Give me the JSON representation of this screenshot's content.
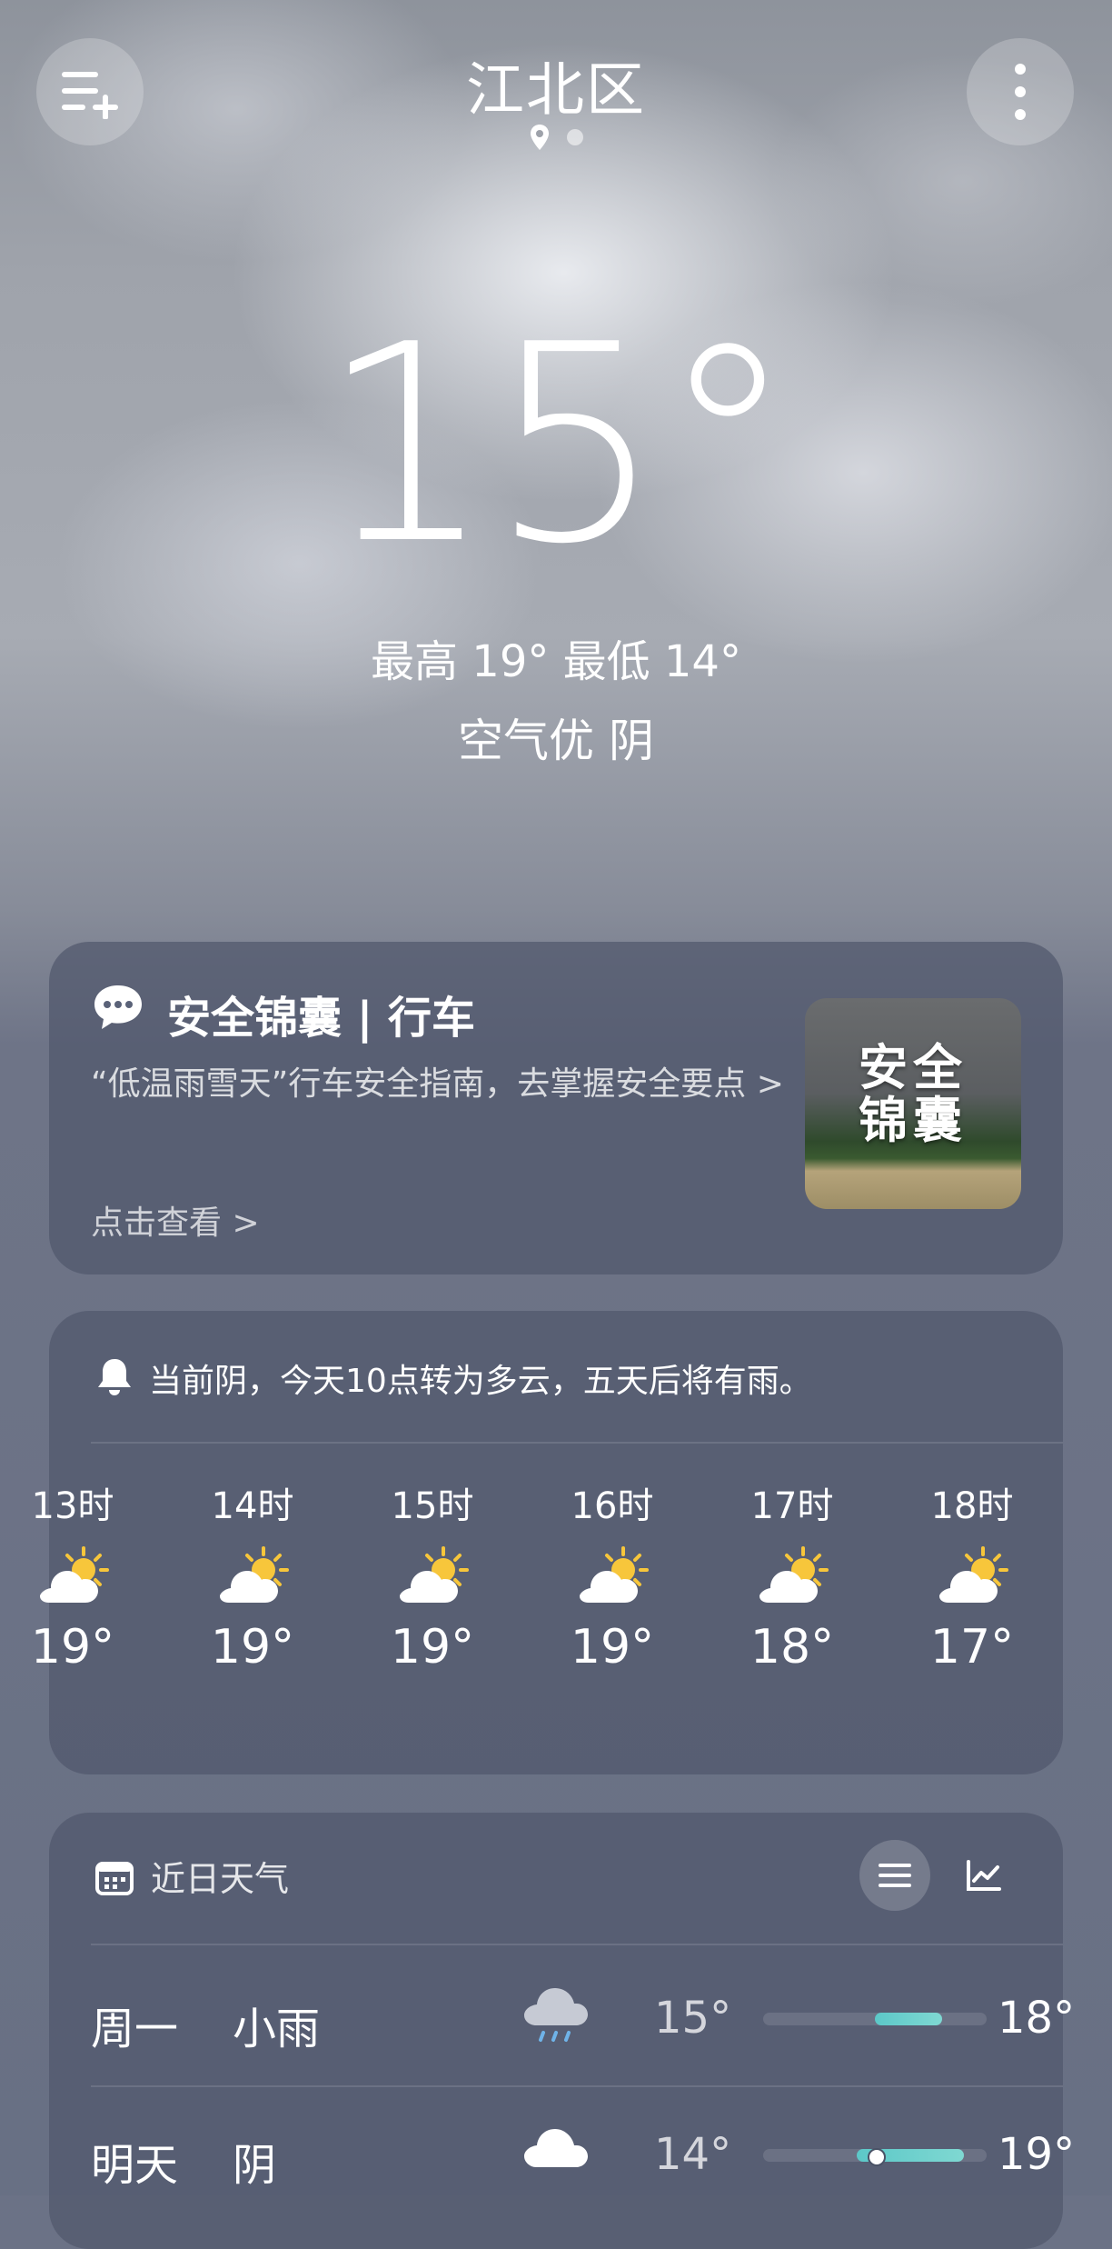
{
  "header": {
    "city": "江北区",
    "page_dots": 2
  },
  "current": {
    "temperature": "15°",
    "hilo": "最高 19° 最低 14°",
    "air_condition": "空气优  阴"
  },
  "safety_card": {
    "title": "安全锦囊 | 行车",
    "description": "“低温雨雪天”行车安全指南，去掌握安全要点 >",
    "link": "点击查看 >",
    "thumb_line1": "安全",
    "thumb_line2": "锦囊"
  },
  "hourly": {
    "alert": "当前阴，今天10点转为多云，五天后将有雨。",
    "items": [
      {
        "hour": "13时",
        "icon": "partly-cloudy-icon",
        "temp": "19°"
      },
      {
        "hour": "14时",
        "icon": "partly-cloudy-icon",
        "temp": "19°"
      },
      {
        "hour": "15时",
        "icon": "partly-cloudy-icon",
        "temp": "19°"
      },
      {
        "hour": "16时",
        "icon": "partly-cloudy-icon",
        "temp": "19°"
      },
      {
        "hour": "17时",
        "icon": "partly-cloudy-icon",
        "temp": "18°"
      },
      {
        "hour": "18时",
        "icon": "partly-cloudy-icon",
        "temp": "17°"
      }
    ]
  },
  "daily": {
    "title": "近日天气",
    "days": [
      {
        "day": "周一",
        "condition": "小雨",
        "icon": "rain-cloud-icon",
        "low": "15°",
        "high": "18°",
        "bar_start": 0.5,
        "bar_end": 0.8,
        "marker": false
      },
      {
        "day": "明天",
        "condition": "阴",
        "icon": "cloud-icon",
        "low": "14°",
        "high": "19°",
        "bar_start": 0.42,
        "bar_end": 0.9,
        "marker": true
      }
    ]
  },
  "colors": {
    "accent_sun": "#f7c63b",
    "bar_fill": "#6fd2cc",
    "card_bg": "#505a6c"
  }
}
